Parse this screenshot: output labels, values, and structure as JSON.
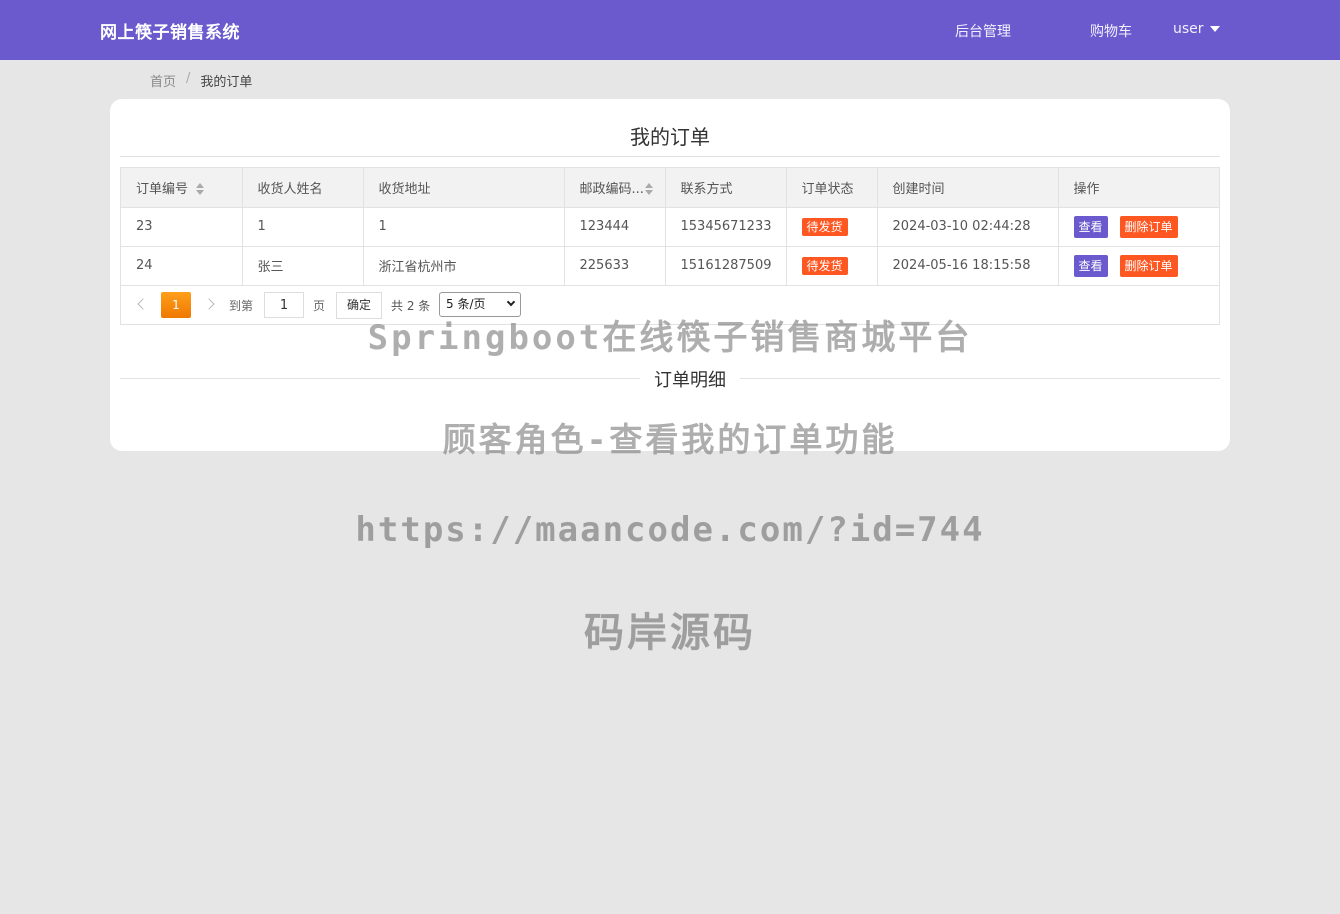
{
  "header": {
    "brand": "网上筷子销售系统",
    "nav_admin": "后台管理",
    "nav_cart": "购物车",
    "nav_user": "user"
  },
  "breadcrumb": {
    "home": "首页",
    "separator": "/",
    "current": "我的订单"
  },
  "orders": {
    "title": "我的订单",
    "columns": [
      "订单编号",
      "收货人姓名",
      "收货地址",
      "邮政编码...",
      "联系方式",
      "订单状态",
      "创建时间",
      "操作"
    ],
    "rows": [
      {
        "id": "23",
        "name": "1",
        "address": "1",
        "zip": "123444",
        "phone": "15345671233",
        "status": "待发货",
        "created": "2024-03-10 02:44:28"
      },
      {
        "id": "24",
        "name": "张三",
        "address": "浙江省杭州市",
        "zip": "225633",
        "phone": "15161287509",
        "status": "待发货",
        "created": "2024-05-16 18:15:58"
      }
    ],
    "view_label": "查看",
    "delete_label": "删除订单"
  },
  "pager": {
    "current_page": "1",
    "goto_label": "到第",
    "goto_value": "1",
    "page_label": "页",
    "confirm_label": "确定",
    "total_label": "共 2 条",
    "page_size": "5 条/页"
  },
  "detail": {
    "title": "订单明细"
  },
  "watermarks": {
    "line1": "Springboot在线筷子销售商城平台",
    "line2": "顾客角色-查看我的订单功能",
    "line3": "https://maancode.com/?id=744",
    "line4": "码岸源码"
  },
  "colors": {
    "primary": "#6a5acd",
    "danger": "#ff5722",
    "pager_active": "#f07800"
  }
}
